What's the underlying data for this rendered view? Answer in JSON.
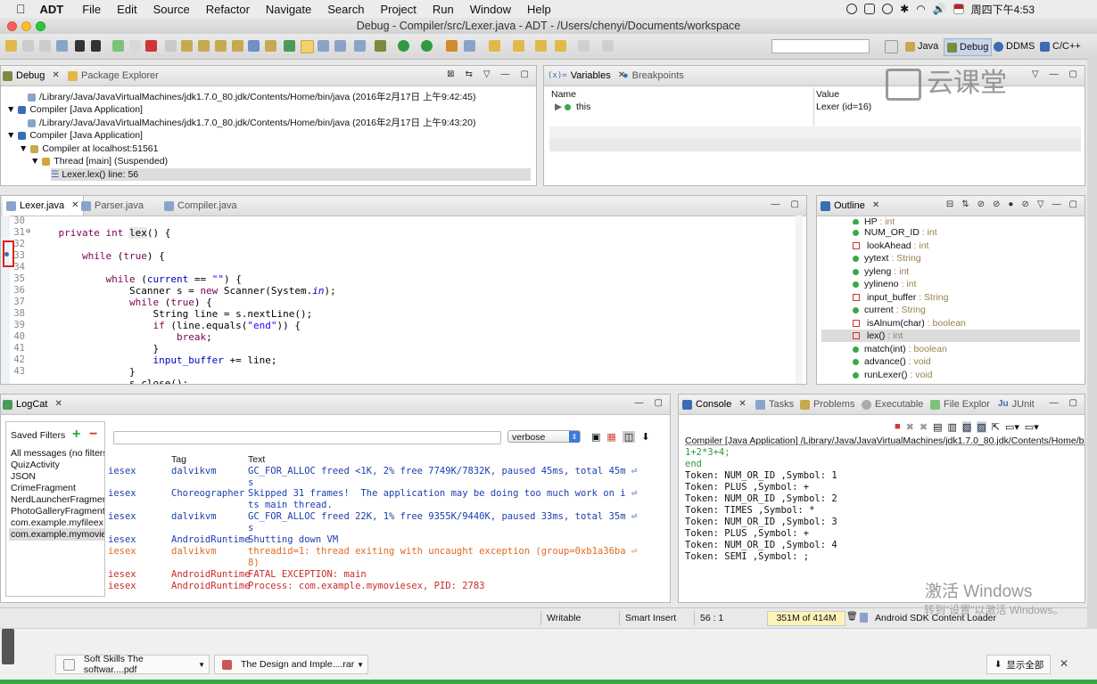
{
  "menubar": {
    "app": "ADT",
    "items": [
      "File",
      "Edit",
      "Source",
      "Refactor",
      "Navigate",
      "Search",
      "Project",
      "Run",
      "Window",
      "Help"
    ],
    "clock": "周四下午4:53"
  },
  "window_title": "Debug - Compiler/src/Lexer.java - ADT - /Users/chenyi/Documents/workspace",
  "perspectives": [
    "Java",
    "Debug",
    "DDMS",
    "C/C++"
  ],
  "debug": {
    "tab_debug": "Debug",
    "tab_pkg": "Package Explorer",
    "rows": [
      "/Library/Java/JavaVirtualMachines/jdk1.7.0_80.jdk/Contents/Home/bin/java (2016年2月17日 上午9:42:45)",
      "Compiler [Java Application]",
      "/Library/Java/JavaVirtualMachines/jdk1.7.0_80.jdk/Contents/Home/bin/java (2016年2月17日 上午9:43:20)",
      "Compiler [Java Application]",
      "Compiler at localhost:51561",
      "Thread [main] (Suspended)",
      "Lexer.lex() line: 56"
    ]
  },
  "variables": {
    "tab_vars": "Variables",
    "tab_bp": "Breakpoints",
    "col_name": "Name",
    "col_value": "Value",
    "var_name": "this",
    "var_value": "Lexer  (id=16)"
  },
  "watermark": "云课堂",
  "editor": {
    "tabs": [
      "Lexer.java",
      "Parser.java",
      "Compiler.java"
    ],
    "line_numbers": [
      "30",
      "31",
      "32",
      "33",
      "34",
      "35",
      "36",
      "37",
      "38",
      "39",
      "40",
      "41",
      "42",
      "43"
    ]
  },
  "outline": {
    "tab": "Outline",
    "items": [
      {
        "name": "HP",
        "type": " : int",
        "icon": "green"
      },
      {
        "name": "NUM_OR_ID",
        "type": " : int",
        "icon": "green-sf"
      },
      {
        "name": "lookAhead",
        "type": " : int",
        "icon": "red"
      },
      {
        "name": "yytext",
        "type": " : String",
        "icon": "green"
      },
      {
        "name": "yyleng",
        "type": " : int",
        "icon": "green"
      },
      {
        "name": "yylineno",
        "type": " : int",
        "icon": "green"
      },
      {
        "name": "input_buffer",
        "type": " : String",
        "icon": "red"
      },
      {
        "name": "current",
        "type": " : String",
        "icon": "green"
      },
      {
        "name": "isAlnum(char)",
        "type": " : boolean",
        "icon": "red"
      },
      {
        "name": "lex()",
        "type": " : int",
        "icon": "red"
      },
      {
        "name": "match(int)",
        "type": " : boolean",
        "icon": "green"
      },
      {
        "name": "advance()",
        "type": " : void",
        "icon": "green"
      },
      {
        "name": "runLexer()",
        "type": " : void",
        "icon": "green"
      }
    ]
  },
  "logcat": {
    "tab": "LogCat",
    "saved_filters": "Saved Filters",
    "filters": [
      "All messages (no filters",
      "QuizActivity",
      "JSON",
      "CrimeFragment",
      "NerdLauncherFragmen",
      "PhotoGalleryFragment",
      "com.example.myfileex",
      "com.example.mymovie"
    ],
    "level": "verbose",
    "col_tag": "Tag",
    "col_text": "Text",
    "rows": [
      {
        "app": "iesex",
        "tag": "dalvikvm",
        "text": "GC_FOR_ALLOC freed <1K, 2% free 7749K/7832K, paused 45ms, total 45m ⏎",
        "cont": "s",
        "color": "lcb"
      },
      {
        "app": "iesex",
        "tag": "Choreographer",
        "text": "Skipped 31 frames!  The application may be doing too much work on i ⏎",
        "cont": "ts main thread.",
        "color": "lcb"
      },
      {
        "app": "iesex",
        "tag": "dalvikvm",
        "text": "GC_FOR_ALLOC freed 22K, 1% free 9355K/9440K, paused 33ms, total 35m ⏎",
        "cont": "s",
        "color": "lcb"
      },
      {
        "app": "iesex",
        "tag": "AndroidRuntime",
        "text": "Shutting down VM",
        "cont": "",
        "color": "lcb"
      },
      {
        "app": "iesex",
        "tag": "dalvikvm",
        "text": "threadid=1: thread exiting with uncaught exception (group=0xb1a36ba ⏎",
        "cont": "8)",
        "color": "lco"
      },
      {
        "app": "iesex",
        "tag": "AndroidRuntime",
        "text": "FATAL EXCEPTION: main",
        "cont": "",
        "color": "lcr"
      },
      {
        "app": "iesex",
        "tag": "AndroidRuntime",
        "text": "Process: com.example.mymoviesex, PID: 2783",
        "cont": "",
        "color": "lcr"
      }
    ]
  },
  "console": {
    "tabs": [
      "Console",
      "Tasks",
      "Problems",
      "Executable",
      "File Explor",
      "JUnit"
    ],
    "header": "Compiler [Java Application] /Library/Java/JavaVirtualMachines/jdk1.7.0_80.jdk/Contents/Home/bin/ja",
    "input_lines": [
      "1+2*3+4;",
      "end"
    ],
    "output_lines": [
      "Token: NUM_OR_ID ,Symbol: 1",
      "Token: PLUS ,Symbol: +",
      "Token: NUM_OR_ID ,Symbol: 2",
      "Token: TIMES ,Symbol: *",
      "Token: NUM_OR_ID ,Symbol: 3",
      "Token: PLUS ,Symbol: +",
      "Token: NUM_OR_ID ,Symbol: 4",
      "Token: SEMI ,Symbol: ;"
    ]
  },
  "activate_windows": {
    "line1": "激活 Windows",
    "line2": "转到\"设置\"以激活 Windows。"
  },
  "status": {
    "writable": "Writable",
    "insert": "Smart Insert",
    "position": "56 : 1",
    "heap": "351M of 414M",
    "loader": "Android SDK Content Loader"
  },
  "downloads": {
    "file1": "Soft Skills The softwar....pdf",
    "file2": "The Design and Imple....rar",
    "show_all": "显示全部"
  }
}
